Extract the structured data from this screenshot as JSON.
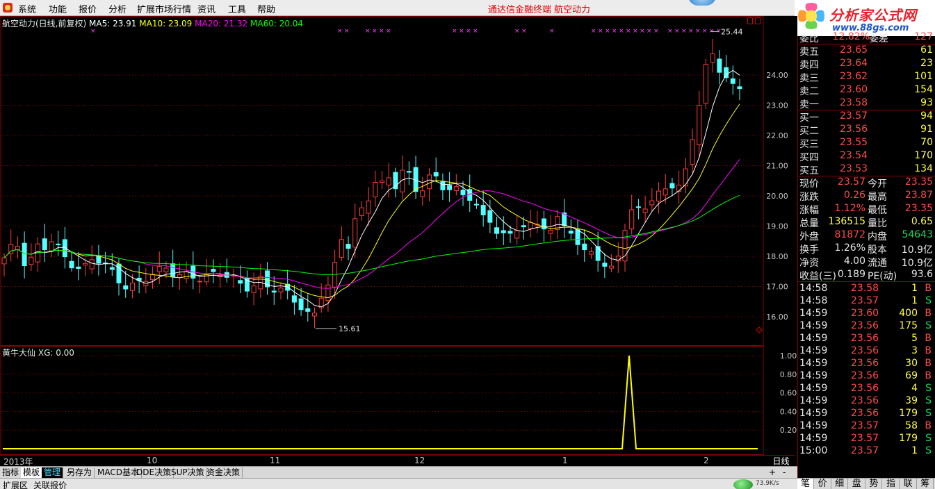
{
  "menubar": {
    "items": [
      "系统",
      "功能",
      "报价",
      "分析",
      "扩展市场行情",
      "资讯",
      "工具",
      "帮助"
    ],
    "promo1": "通达信金融终端",
    "promo2": "航空动力"
  },
  "banner": {
    "title": "分析家公式网",
    "url": "www.88gs.com"
  },
  "chart": {
    "header": {
      "name": "航空动力(日线,前复权)",
      "ma5": "MA5: 23.91",
      "ma10": "MA10: 23.09",
      "ma20": "MA20: 21.32",
      "ma60": "MA60: 20.04"
    },
    "max_label": "25.44",
    "min_label": "15.61",
    "price_axis": [
      "24.00",
      "23.00",
      "22.00",
      "21.00",
      "20.00",
      "19.00",
      "18.00",
      "17.00",
      "16.00"
    ],
    "colors": {
      "up": "#ff3b3b",
      "down": "#54ffff",
      "ma5": "#ffffff",
      "ma10": "#ffff00",
      "ma20": "#ff00ff",
      "ma60": "#00ff00",
      "grid": "#8a0000"
    }
  },
  "indicator": {
    "title": "黄牛大仙",
    "xg": "XG: 0.00",
    "axis": [
      "1.00",
      "0.80",
      "0.60",
      "0.40",
      "0.20"
    ]
  },
  "chart_data": {
    "type": "candlestick",
    "title": "航空动力(日线,前复权)",
    "ylim": [
      15.5,
      25.5
    ],
    "max": 25.44,
    "min": 15.61,
    "ma_latest": {
      "MA5": 23.91,
      "MA10": 23.09,
      "MA20": 21.32,
      "MA60": 20.04
    },
    "x_month_labels": [
      "2013年",
      "10",
      "11",
      "12",
      "1",
      "2"
    ],
    "indicator_signal": {
      "name": "黄牛大仙",
      "peak_value": 1.0,
      "xg": 0.0
    }
  },
  "dates": [
    "2013年",
    "10",
    "11",
    "12",
    "1",
    "2"
  ],
  "period_label": "日线",
  "tabs": [
    "指标",
    "模板",
    "管理",
    "另存为",
    "MACD基本",
    "DDE决策",
    "SUP决策",
    "资金决策"
  ],
  "tabs_right": [
    "+",
    "-"
  ],
  "status": {
    "left1": "扩展区",
    "left2": "关联报价",
    "speed": "73.9K/s"
  },
  "quote": {
    "top": {
      "l1": "委比",
      "v1": "12.82%",
      "l2": "委差",
      "v2": "127"
    },
    "sell": [
      {
        "label": "卖五",
        "price": "23.65",
        "vol": "61"
      },
      {
        "label": "卖四",
        "price": "23.64",
        "vol": "23"
      },
      {
        "label": "卖三",
        "price": "23.62",
        "vol": "101"
      },
      {
        "label": "卖二",
        "price": "23.60",
        "vol": "154"
      },
      {
        "label": "卖一",
        "price": "23.58",
        "vol": "93"
      }
    ],
    "buy": [
      {
        "label": "买一",
        "price": "23.57",
        "vol": "94"
      },
      {
        "label": "买二",
        "price": "23.56",
        "vol": "91"
      },
      {
        "label": "买三",
        "price": "23.55",
        "vol": "70"
      },
      {
        "label": "买四",
        "price": "23.54",
        "vol": "170"
      },
      {
        "label": "买五",
        "price": "23.53",
        "vol": "134"
      }
    ],
    "stats": [
      {
        "l1": "现价",
        "v1": "23.57",
        "c1": "r",
        "l2": "今开",
        "v2": "23.35",
        "c2": "r"
      },
      {
        "l1": "涨跌",
        "v1": "0.26",
        "c1": "r",
        "l2": "最高",
        "v2": "23.87",
        "c2": "r"
      },
      {
        "l1": "涨幅",
        "v1": "1.12%",
        "c1": "r",
        "l2": "最低",
        "v2": "23.35",
        "c2": "r"
      },
      {
        "l1": "总量",
        "v1": "136515",
        "c1": "y",
        "l2": "量比",
        "v2": "0.65",
        "c2": "y"
      },
      {
        "l1": "外盘",
        "v1": "81872",
        "c1": "r",
        "l2": "内盘",
        "v2": "54643",
        "c2": "g"
      },
      {
        "l1": "换手",
        "v1": "1.26%",
        "c1": "w",
        "l2": "股本",
        "v2": "10.9亿",
        "c2": "w"
      },
      {
        "l1": "净资",
        "v1": "4.00",
        "c1": "w",
        "l2": "流通",
        "v2": "10.9亿",
        "c2": "w"
      },
      {
        "l1": "收益(三)",
        "v1": "0.189",
        "c1": "w",
        "l2": "PE(动)",
        "v2": "93.6",
        "c2": "w"
      }
    ],
    "ticks": [
      {
        "t": "14:58",
        "p": "23.58",
        "v": "1",
        "s": "B"
      },
      {
        "t": "14:58",
        "p": "23.57",
        "v": "1",
        "s": "S"
      },
      {
        "t": "14:59",
        "p": "23.60",
        "v": "400",
        "s": "B"
      },
      {
        "t": "14:59",
        "p": "23.56",
        "v": "175",
        "s": "S"
      },
      {
        "t": "14:59",
        "p": "23.56",
        "v": "5",
        "s": "B"
      },
      {
        "t": "14:59",
        "p": "23.56",
        "v": "3",
        "s": "B"
      },
      {
        "t": "14:59",
        "p": "23.56",
        "v": "30",
        "s": "B"
      },
      {
        "t": "14:59",
        "p": "23.56",
        "v": "69",
        "s": "B"
      },
      {
        "t": "14:59",
        "p": "23.56",
        "v": "4",
        "s": "S"
      },
      {
        "t": "14:59",
        "p": "23.56",
        "v": "39",
        "s": "S"
      },
      {
        "t": "14:59",
        "p": "23.56",
        "v": "179",
        "s": "S"
      },
      {
        "t": "14:59",
        "p": "23.57",
        "v": "58",
        "s": "B"
      },
      {
        "t": "14:59",
        "p": "23.57",
        "v": "179",
        "s": "S"
      },
      {
        "t": "15:00",
        "p": "23.57",
        "v": "1",
        "s": "S"
      }
    ],
    "tabs": [
      "笔",
      "价",
      "细",
      "盘",
      "势",
      "指",
      "联",
      "筹"
    ]
  }
}
